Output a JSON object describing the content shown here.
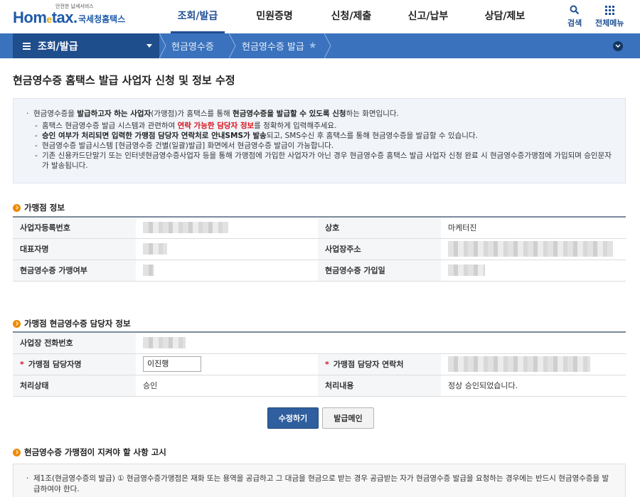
{
  "header": {
    "logo_small": "안전한 납세서비스",
    "logo_text": "Hom",
    "logo_e": "e",
    "logo_text2": "tax.",
    "logo_kr": "국세청홈택스",
    "nav": [
      "조회/발급",
      "민원증명",
      "신청/제출",
      "신고/납부",
      "상담/제보"
    ],
    "search_label": "검색",
    "allmenu_label": "전체메뉴"
  },
  "locbar": {
    "menu_label": "조회/발급",
    "step1": "현금영수증",
    "step2": "현금영수증 발급"
  },
  "page_title": "현금영수증 홈택스 발급 사업자 신청 및 정보 수정",
  "notice": {
    "l1_a": "현금영수증을 ",
    "l1_b": "발급하고자 하는 사업자",
    "l1_c": "(가맹점)가 홈택스를 통해 ",
    "l1_d": "현금영수증을 발급할 수 있도록 신청",
    "l1_e": "하는 화면입니다.",
    "s1_a": "홈택스 현금영수증 발급 시스템과 관련하여 ",
    "s1_b": "연락 가능한 담당자 정보",
    "s1_c": "를 정확하게 입력해주세요.",
    "s2_a": "승인 여부가 처리되면 입력한 가맹점 담당자 연락처로 안내SMS가 발송",
    "s2_b": "되고, SMS수신 후 홈택스를 통해 현금영수증을 발급할 수 있습니다.",
    "s3": "현금영수증 발급시스템 [현금영수증 건별(일괄)발급] 화면에서 현금영수증 발급이 가능합니다.",
    "s4": "기존 신용카드단말기 또는 인터넷현금영수증사업자 등을 통해 가맹점에 가입한 사업자가 아닌 경우 현금영수증 홈택스 발급 사업자 신청 완료 시 현금영수증가맹점에 가입되며 승인문자가 발송됩니다."
  },
  "section1": {
    "title": "가맹점 정보",
    "biz_no_label": "사업자등록번호",
    "trade_name_label": "상호",
    "trade_name_value": "마케터진",
    "ceo_label": "대표자명",
    "address_label": "사업장주소",
    "member_label": "현금영수증 가맹여부",
    "join_date_label": "현금영수증 가입일"
  },
  "section2": {
    "title": "가맹점 현금영수증 담당자 정보",
    "phone_label": "사업장 전화번호",
    "manager_name_label": "가맹점 담당자명",
    "manager_name_value": "이진행",
    "manager_contact_label": "가맹점 담당자 연락처",
    "status_label": "처리상태",
    "status_value": "승인",
    "result_label": "처리내용",
    "result_value": "정상 승인되었습니다."
  },
  "buttons": {
    "edit": "수정하기",
    "issue_main": "발급메인"
  },
  "section3": {
    "title": "현금영수증 가맹점이 지켜야 할 사항 고시",
    "text": "제1조(현금영수증의 발급) ① 현금영수증가맹점은 재화 또는 용역을 공급하고 그 대금을 현금으로 받는 경우 공급받는 자가 현금영수증 발급을 요청하는 경우에는 반드시 현금영수증을 발급하여야 한다."
  },
  "colors": {
    "brand_blue": "#1f4f93",
    "locbar_blue": "#3a72bd",
    "locbar_dark": "#1f4e8c",
    "accent_orange": "#ef8a00",
    "required_red": "#d8121b"
  }
}
